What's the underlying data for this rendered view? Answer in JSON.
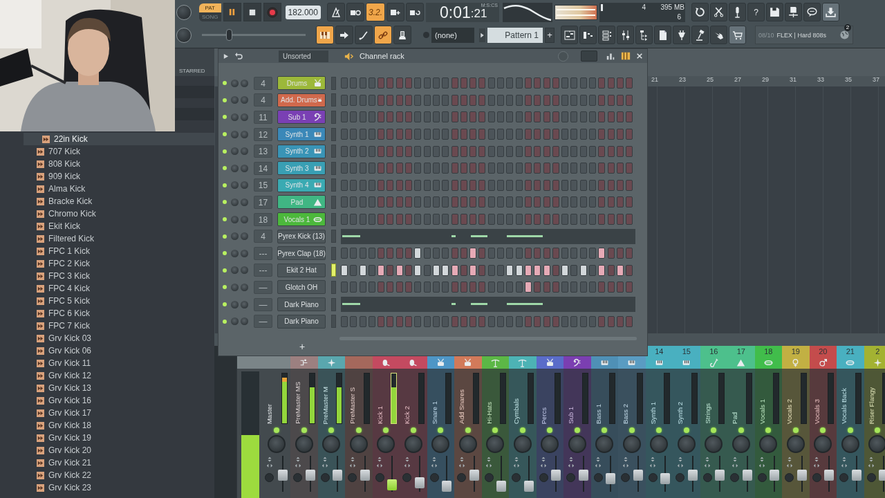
{
  "toolbar": {
    "pat_song": [
      {
        "label": "PAT",
        "selected": true
      },
      {
        "label": "SONG",
        "selected": false
      }
    ],
    "transport": [
      {
        "kind": "pause",
        "on": true
      },
      {
        "kind": "stop",
        "on": false
      },
      {
        "kind": "record",
        "on": false
      }
    ],
    "tempo": "182.000",
    "row1_buttons": [
      {
        "kind": "metronome",
        "on": false
      },
      {
        "kind": "wait",
        "on": false
      },
      {
        "kind": "countdown",
        "label": "3.2.",
        "on": true
      },
      {
        "kind": "overdub",
        "on": false
      },
      {
        "kind": "loop",
        "on": false
      }
    ],
    "time_main": "0:01",
    "time_fraction": ":21",
    "time_unit": "M:S:CS",
    "cpu": "4",
    "memory": "395 MB",
    "polyphony": "6",
    "right_buttons": [
      {
        "kind": "undo",
        "on": false
      },
      {
        "kind": "cut",
        "on": false
      },
      {
        "kind": "mic",
        "on": false
      },
      {
        "kind": "help",
        "label": "?",
        "on": false
      },
      {
        "kind": "save",
        "on": false
      },
      {
        "kind": "export",
        "on": false
      },
      {
        "kind": "chat",
        "on": false
      },
      {
        "kind": "download",
        "on": true
      }
    ],
    "pitch": {
      "level": 0.25
    },
    "row2_buttons": [
      {
        "kind": "piano",
        "on": true
      },
      {
        "kind": "arrow",
        "on": false
      },
      {
        "kind": "curve",
        "on": false
      },
      {
        "kind": "link",
        "on": true
      },
      {
        "kind": "typing",
        "on": false
      }
    ],
    "channel_selector": "(none)",
    "pattern": "Pattern 1",
    "pattern_add": "+",
    "window_buttons": [
      {
        "kind": "playlist",
        "on": false
      },
      {
        "kind": "steps",
        "on": false
      },
      {
        "kind": "rack",
        "on": false
      },
      {
        "kind": "mixer",
        "on": false
      },
      {
        "kind": "browser",
        "on": false
      },
      {
        "kind": "file",
        "on": false
      },
      {
        "kind": "plugin",
        "on": false
      },
      {
        "kind": "hammer",
        "on": false
      },
      {
        "kind": "hand",
        "on": false
      },
      {
        "kind": "cart",
        "on": true
      }
    ],
    "hint": {
      "count": "08/10",
      "text": "FLEX | Hard 808s",
      "badge": "2"
    }
  },
  "browser": {
    "starred_label": "STARRED",
    "items": [
      {
        "label": "22in Kick",
        "selected": true
      },
      {
        "label": "707 Kick",
        "selected": false
      },
      {
        "label": "808 Kick",
        "selected": false
      },
      {
        "label": "909 Kick",
        "selected": false
      },
      {
        "label": "Alma Kick",
        "selected": false
      },
      {
        "label": "Bracke Kick",
        "selected": false
      },
      {
        "label": "Chromo Kick",
        "selected": false
      },
      {
        "label": "Ekit Kick",
        "selected": false
      },
      {
        "label": "Filtered Kick",
        "selected": false
      },
      {
        "label": "FPC 1 Kick",
        "selected": false
      },
      {
        "label": "FPC 2 Kick",
        "selected": false
      },
      {
        "label": "FPC 3 Kick",
        "selected": false
      },
      {
        "label": "FPC 4 Kick",
        "selected": false
      },
      {
        "label": "FPC 5 Kick",
        "selected": false
      },
      {
        "label": "FPC 6 Kick",
        "selected": false
      },
      {
        "label": "FPC 7 Kick",
        "selected": false
      },
      {
        "label": "Grv Kick 03",
        "selected": false
      },
      {
        "label": "Grv Kick 06",
        "selected": false
      },
      {
        "label": "Grv Kick 11",
        "selected": false
      },
      {
        "label": "Grv Kick 12",
        "selected": false
      },
      {
        "label": "Grv Kick 13",
        "selected": false
      },
      {
        "label": "Grv Kick 16",
        "selected": false
      },
      {
        "label": "Grv Kick 17",
        "selected": false
      },
      {
        "label": "Grv Kick 18",
        "selected": false
      },
      {
        "label": "Grv Kick 19",
        "selected": false
      },
      {
        "label": "Grv Kick 20",
        "selected": false
      },
      {
        "label": "Grv Kick 21",
        "selected": false
      },
      {
        "label": "Grv Kick 22",
        "selected": false
      },
      {
        "label": "Grv Kick 23",
        "selected": false
      }
    ]
  },
  "playlist": {
    "ruler": [
      "21",
      "23",
      "25",
      "27",
      "29",
      "31",
      "33",
      "35",
      "37"
    ]
  },
  "channel_rack": {
    "title": "Channel rack",
    "filter": "Unsorted",
    "add_channel": "+",
    "rows": [
      {
        "number": "4",
        "name": "Drums",
        "color": "#9cb83a",
        "kind": "drum",
        "selected": false,
        "steps": [
          false,
          false,
          false,
          false,
          false,
          false,
          false,
          false,
          false,
          false,
          false,
          false,
          false,
          false,
          false,
          false,
          false,
          false,
          false,
          false,
          false,
          false,
          false,
          false,
          false,
          false,
          false,
          false,
          false,
          false,
          false,
          false
        ]
      },
      {
        "number": "4",
        "name": "Add. Drums",
        "color": "#d0694c",
        "kind": "drum",
        "selected": false,
        "steps": [
          false,
          false,
          false,
          false,
          false,
          false,
          false,
          false,
          false,
          false,
          false,
          false,
          false,
          false,
          false,
          false,
          false,
          false,
          false,
          false,
          false,
          false,
          false,
          false,
          false,
          false,
          false,
          false,
          false,
          false,
          false,
          false
        ]
      },
      {
        "number": "11",
        "name": "Sub 1",
        "color": "#7a40b4",
        "kind": "clef",
        "selected": false,
        "steps": [
          false,
          false,
          false,
          false,
          false,
          false,
          false,
          false,
          false,
          false,
          false,
          false,
          false,
          false,
          false,
          false,
          false,
          false,
          false,
          false,
          false,
          false,
          false,
          false,
          false,
          false,
          false,
          false,
          false,
          false,
          false,
          false
        ]
      },
      {
        "number": "12",
        "name": "Synth 1",
        "color": "#3b88b8",
        "kind": "keys",
        "selected": false,
        "steps": [
          false,
          false,
          false,
          false,
          false,
          false,
          false,
          false,
          false,
          false,
          false,
          false,
          false,
          false,
          false,
          false,
          false,
          false,
          false,
          false,
          false,
          false,
          false,
          false,
          false,
          false,
          false,
          false,
          false,
          false,
          false,
          false
        ]
      },
      {
        "number": "13",
        "name": "Synth 2",
        "color": "#3994b6",
        "kind": "keys",
        "selected": false,
        "steps": [
          false,
          false,
          false,
          false,
          false,
          false,
          false,
          false,
          false,
          false,
          false,
          false,
          false,
          false,
          false,
          false,
          false,
          false,
          false,
          false,
          false,
          false,
          false,
          false,
          false,
          false,
          false,
          false,
          false,
          false,
          false,
          false
        ]
      },
      {
        "number": "14",
        "name": "Synth 3",
        "color": "#399fb4",
        "kind": "keys",
        "selected": false,
        "steps": [
          false,
          false,
          false,
          false,
          false,
          false,
          false,
          false,
          false,
          false,
          false,
          false,
          false,
          false,
          false,
          false,
          false,
          false,
          false,
          false,
          false,
          false,
          false,
          false,
          false,
          false,
          false,
          false,
          false,
          false,
          false,
          false
        ]
      },
      {
        "number": "15",
        "name": "Synth 4",
        "color": "#3aaab2",
        "kind": "keys",
        "selected": false,
        "steps": [
          false,
          false,
          false,
          false,
          false,
          false,
          false,
          false,
          false,
          false,
          false,
          false,
          false,
          false,
          false,
          false,
          false,
          false,
          false,
          false,
          false,
          false,
          false,
          false,
          false,
          false,
          false,
          false,
          false,
          false,
          false,
          false
        ]
      },
      {
        "number": "17",
        "name": "Pad",
        "color": "#40b683",
        "kind": "triangle",
        "selected": false,
        "steps": [
          false,
          false,
          false,
          false,
          false,
          false,
          false,
          false,
          false,
          false,
          false,
          false,
          false,
          false,
          false,
          false,
          false,
          false,
          false,
          false,
          false,
          false,
          false,
          false,
          false,
          false,
          false,
          false,
          false,
          false,
          false,
          false
        ]
      },
      {
        "number": "18",
        "name": "Vocals 1",
        "color": "#4cb83c",
        "kind": "lips",
        "selected": false,
        "steps": [
          false,
          false,
          false,
          false,
          false,
          false,
          false,
          false,
          false,
          false,
          false,
          false,
          false,
          false,
          false,
          false,
          false,
          false,
          false,
          false,
          false,
          false,
          false,
          false,
          false,
          false,
          false,
          false,
          false,
          false,
          false,
          false
        ]
      },
      {
        "number": "4",
        "name": "Pyrex Kick (13)",
        "kind": "roll",
        "selected": false
      },
      {
        "number": "---",
        "name": "Pyrex Clap (18)",
        "kind": "plain",
        "selected": false,
        "steps": [
          false,
          false,
          false,
          false,
          false,
          false,
          false,
          false,
          true,
          false,
          false,
          false,
          false,
          false,
          true,
          false,
          false,
          false,
          false,
          false,
          false,
          false,
          false,
          false,
          false,
          false,
          false,
          false,
          true,
          false,
          false,
          false
        ]
      },
      {
        "number": "---",
        "name": "Ekit 2 Hat",
        "kind": "plain",
        "selected": true,
        "steps": [
          true,
          false,
          true,
          false,
          true,
          false,
          true,
          false,
          true,
          false,
          true,
          true,
          true,
          false,
          true,
          false,
          false,
          false,
          true,
          true,
          true,
          true,
          true,
          false,
          true,
          false,
          true,
          false,
          true,
          false,
          true,
          false
        ]
      },
      {
        "number": "—",
        "name": "Glotch OH",
        "kind": "plain",
        "selected": false,
        "steps": [
          false,
          false,
          false,
          false,
          false,
          false,
          false,
          false,
          false,
          false,
          false,
          false,
          false,
          false,
          false,
          false,
          false,
          false,
          false,
          false,
          true,
          false,
          false,
          false,
          false,
          false,
          false,
          false,
          false,
          false,
          false,
          false
        ]
      },
      {
        "number": "—",
        "name": "Dark Piano",
        "kind": "roll",
        "selected": false
      },
      {
        "number": "—",
        "name": "Dark Piano",
        "kind": "plain",
        "selected": false,
        "steps": [
          false,
          false,
          false,
          false,
          false,
          false,
          false,
          false,
          false,
          false,
          false,
          false,
          false,
          false,
          false,
          false,
          false,
          false,
          false,
          false,
          false,
          false,
          false,
          false,
          false,
          false,
          false,
          false,
          false,
          false,
          false,
          false
        ]
      }
    ]
  },
  "mixer": {
    "master": {
      "name": "Master",
      "color": "#7b8588",
      "selected": false,
      "big_meter": {
        "level": 0.5
      },
      "meter": {
        "level": 0.92
      },
      "fader": {
        "level": 0.45
      }
    },
    "strips": [
      {
        "name": "PreMaster MS",
        "color": "#9c8080",
        "kind": "route",
        "selected": false,
        "meter": {
          "level": 0.72
        },
        "fader": {
          "level": 0.45
        }
      },
      {
        "name": "PreMaster M",
        "color": "#5aa7ae",
        "kind": "sparkle",
        "selected": false,
        "meter": {
          "level": 0.72
        },
        "fader": {
          "level": 0.45
        }
      },
      {
        "name": "PreMaster S",
        "color": "#a5685c",
        "kind": "none",
        "selected": false,
        "meter": {
          "level": 0
        },
        "fader": {
          "level": 0.45
        }
      },
      {
        "name": "Kick 1",
        "color": "#c44a60",
        "kind": "kick",
        "selected": true,
        "meter": {
          "level": 0.72
        },
        "fader": {
          "level": 0.05
        }
      },
      {
        "name": "Kick 2",
        "color": "#c44a60",
        "kind": "kick",
        "selected": false,
        "meter": {
          "level": 0
        },
        "fader": {
          "level": 0.15
        }
      },
      {
        "name": "Snare 1",
        "color": "#4e96c6",
        "kind": "drum",
        "selected": false,
        "meter": {
          "level": 0
        },
        "fader": {
          "level": 0
        }
      },
      {
        "name": "Add Snares",
        "color": "#d27a5a",
        "kind": "drum",
        "selected": false,
        "meter": {
          "level": 0
        },
        "fader": {
          "level": 0.45
        }
      },
      {
        "name": "Hi-Hats",
        "color": "#5cb746",
        "kind": "cymbal",
        "selected": false,
        "meter": {
          "level": 0
        },
        "fader": {
          "level": 0
        }
      },
      {
        "name": "Cymbals",
        "color": "#4db3b5",
        "kind": "cymbal",
        "selected": false,
        "meter": {
          "level": 0
        },
        "fader": {
          "level": 0
        }
      },
      {
        "name": "Percs",
        "color": "#5a6cc9",
        "kind": "drum",
        "selected": false,
        "meter": {
          "level": 0
        },
        "fader": {
          "level": 0.45
        }
      },
      {
        "name": "Sub 1",
        "color": "#7b3fb1",
        "kind": "clef",
        "selected": false,
        "meter": {
          "level": 0
        },
        "fader": {
          "level": 0.45
        }
      },
      {
        "name": "Bass 1",
        "color": "#4f90b6",
        "kind": "keys",
        "selected": false,
        "meter": {
          "level": 0
        },
        "fader": {
          "level": 0.3
        }
      },
      {
        "name": "Bass 2",
        "color": "#5a9cc2",
        "kind": "keys",
        "selected": false,
        "meter": {
          "level": 0
        },
        "fader": {
          "level": 0.45
        }
      },
      {
        "number": "14",
        "name": "Synth 1",
        "color": "#49b0c0",
        "kind": "keys",
        "selected": false,
        "meter": {
          "level": 0
        },
        "fader": {
          "level": 0.3
        }
      },
      {
        "number": "15",
        "name": "Synth 2",
        "color": "#49b0c0",
        "kind": "keys",
        "selected": false,
        "meter": {
          "level": 0
        },
        "fader": {
          "level": 0.45
        }
      },
      {
        "number": "16",
        "name": "Strings",
        "color": "#4dc08c",
        "kind": "violin",
        "selected": false,
        "meter": {
          "level": 0
        },
        "fader": {
          "level": 0.45
        }
      },
      {
        "number": "17",
        "name": "Pad",
        "color": "#4dc08c",
        "kind": "triangle",
        "selected": false,
        "meter": {
          "level": 0
        },
        "fader": {
          "level": 0.45
        }
      },
      {
        "number": "18",
        "name": "Vocals 1",
        "color": "#41bd4b",
        "kind": "lips",
        "selected": false,
        "meter": {
          "level": 0
        },
        "fader": {
          "level": 0.45
        }
      },
      {
        "number": "19",
        "name": "Vocals 2",
        "color": "#c2b043",
        "kind": "female",
        "selected": false,
        "meter": {
          "level": 0
        },
        "fader": {
          "level": 0.45
        }
      },
      {
        "number": "20",
        "name": "Vocals 3",
        "color": "#c44c4c",
        "kind": "male",
        "selected": false,
        "meter": {
          "level": 0
        },
        "fader": {
          "level": 0.45
        }
      },
      {
        "number": "21",
        "name": "Vocals Back",
        "color": "#49b0c0",
        "kind": "lips",
        "selected": false,
        "meter": {
          "level": 0
        },
        "fader": {
          "level": 0.45
        }
      },
      {
        "number": "2",
        "name": "Riser Flangy",
        "color": "#a3b232",
        "kind": "sparkle",
        "selected": false,
        "meter": {
          "level": 0
        },
        "fader": {
          "level": 0.45
        }
      }
    ]
  }
}
